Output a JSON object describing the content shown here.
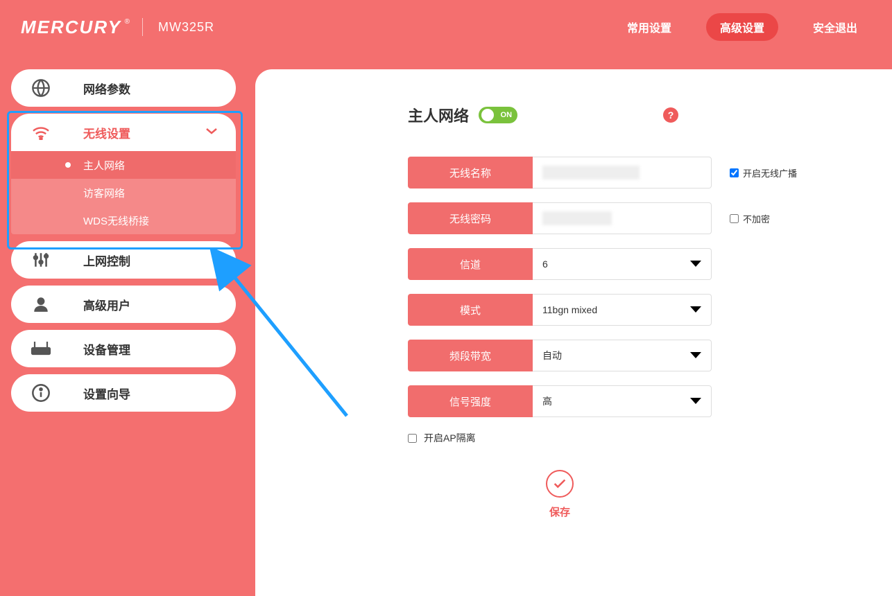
{
  "header": {
    "brand": "MERCURY",
    "model": "MW325R",
    "nav": {
      "common": "常用设置",
      "advanced": "高级设置",
      "logout": "安全退出"
    }
  },
  "sidebar": {
    "network": "网络参数",
    "wireless": "无线设置",
    "submenu": {
      "host": "主人网络",
      "guest": "访客网络",
      "wds": "WDS无线桥接"
    },
    "access": "上网控制",
    "advuser": "高级用户",
    "device": "设备管理",
    "wizard": "设置向导"
  },
  "main": {
    "title": "主人网络",
    "toggle": "ON",
    "fields": {
      "ssid_label": "无线名称",
      "password_label": "无线密码",
      "channel_label": "信道",
      "channel_value": "6",
      "mode_label": "模式",
      "mode_value": "11bgn mixed",
      "bandwidth_label": "频段带宽",
      "bandwidth_value": "自动",
      "signal_label": "信号强度",
      "signal_value": "高"
    },
    "checks": {
      "broadcast": "开启无线广播",
      "noencrypt": "不加密",
      "ap_isolation": "开启AP隔离"
    },
    "save": "保存"
  }
}
